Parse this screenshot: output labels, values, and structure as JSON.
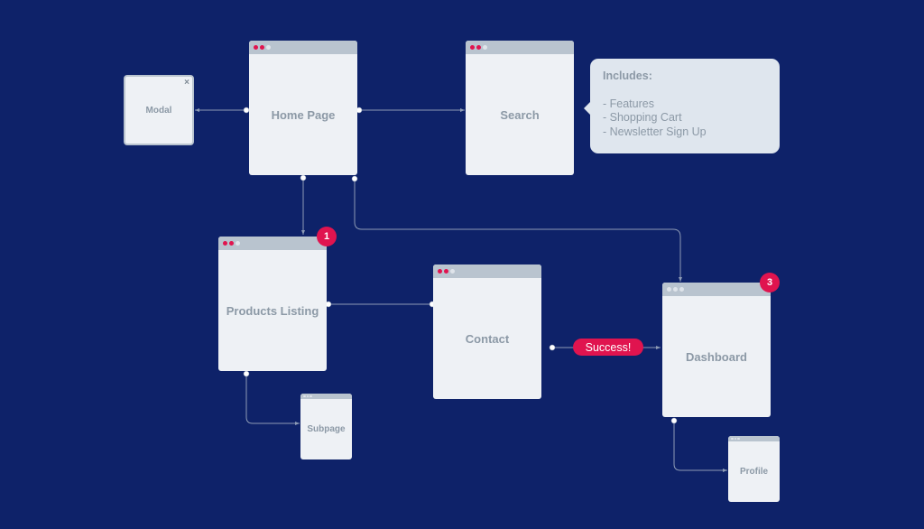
{
  "nodes": {
    "modal": {
      "label": "Modal",
      "close": "×"
    },
    "home": {
      "label": "Home Page"
    },
    "search": {
      "label": "Search"
    },
    "products": {
      "label": "Products Listing",
      "badge": "1"
    },
    "contact": {
      "label": "Contact"
    },
    "dashboard": {
      "label": "Dashboard",
      "badge": "3"
    },
    "subpage": {
      "label": "Subpage"
    },
    "profile": {
      "label": "Profile"
    }
  },
  "tooltip": {
    "title": "Includes:",
    "items": [
      "- Features",
      "- Shopping Cart",
      "- Newsletter Sign Up"
    ]
  },
  "edge_label": "Success!",
  "colors": {
    "background": "#0e2269",
    "accent": "#e0144f",
    "card": "#eef1f5",
    "card_header": "#b9c4cf"
  }
}
